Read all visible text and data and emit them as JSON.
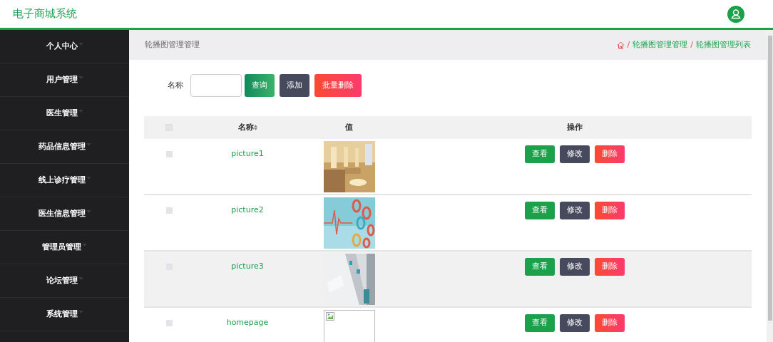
{
  "header": {
    "title": "电子商城系统"
  },
  "sidebar": {
    "items": [
      {
        "label": "个人中心",
        "expanded": false
      },
      {
        "label": "用户管理",
        "expanded": false
      },
      {
        "label": "医生管理",
        "expanded": false
      },
      {
        "label": "药品信息管理",
        "expanded": false
      },
      {
        "label": "线上诊疗管理",
        "expanded": false
      },
      {
        "label": "医生信息管理",
        "expanded": false
      },
      {
        "label": "管理员管理",
        "expanded": false
      },
      {
        "label": "论坛管理",
        "expanded": false
      },
      {
        "label": "系统管理",
        "expanded": false
      }
    ]
  },
  "page_title": "轮播图管理管理",
  "breadcrumb": {
    "separator": "/",
    "items": [
      "轮播图管理管理",
      "轮播图管理列表"
    ]
  },
  "search": {
    "label": "名称",
    "buttons": [
      "查询",
      "添加",
      "批量删除"
    ]
  },
  "table": {
    "columns": [
      "",
      "名称",
      "值",
      "操作"
    ],
    "all_checked": false,
    "rows": [
      {
        "name": "picture1",
        "checked": false,
        "highlighted": false,
        "image": {
          "kind": "picture"
        },
        "actions": [
          "查看",
          "修改",
          "删除"
        ]
      },
      {
        "name": "picture2",
        "checked": false,
        "highlighted": false,
        "image": {
          "kind": "picture"
        },
        "actions": [
          "查看",
          "修改",
          "删除"
        ]
      },
      {
        "name": "picture3",
        "checked": false,
        "highlighted": true,
        "image": {
          "kind": "picture"
        },
        "actions": [
          "查看",
          "修改",
          "删除"
        ]
      },
      {
        "name": "homepage",
        "checked": false,
        "highlighted": false,
        "image": {
          "kind": "broken"
        },
        "actions": [
          "查看",
          "修改",
          "删除"
        ]
      }
    ]
  }
}
